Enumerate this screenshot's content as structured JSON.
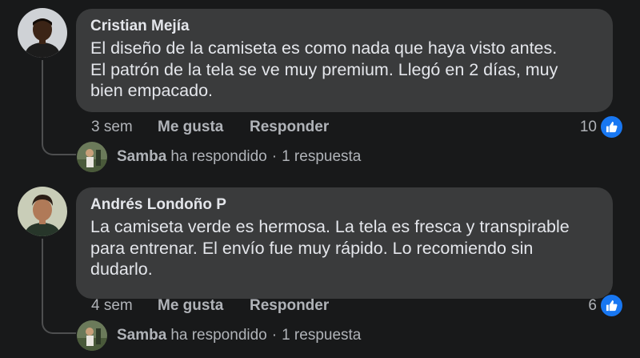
{
  "comments": [
    {
      "author": "Cristian Mejía",
      "lines": [
        "El diseño de la camiseta es como nada que haya visto antes.",
        "El patrón de la tela se ve muy premium. Llegó en 2 días, muy",
        "bien empacado."
      ],
      "time": "3 sem",
      "like_label": "Me gusta",
      "reply_label": "Responder",
      "reaction_count": "10",
      "reply_author": "Samba",
      "reply_text": "ha respondido",
      "reply_separator": "·",
      "reply_count": "1 respuesta"
    },
    {
      "author": "Andrés Londoño P",
      "lines": [
        "La camiseta verde es hermosa. La tela es fresca y transpirable",
        "para entrenar. El envío fue muy rápido. Lo recomiendo sin",
        "dudarlo."
      ],
      "time": "4 sem",
      "like_label": "Me gusta",
      "reply_label": "Responder",
      "reaction_count": "6",
      "reply_author": "Samba",
      "reply_text": "ha respondido",
      "reply_separator": "·",
      "reply_count": "1 respuesta"
    }
  ],
  "icons": {
    "reaction": "thumbs-up-icon"
  },
  "colors": {
    "background": "#18191a",
    "bubble": "#3a3b3c",
    "primary_text": "#e4e6eb",
    "secondary_text": "#b0b3b8",
    "like_blue": "#1877f2"
  }
}
